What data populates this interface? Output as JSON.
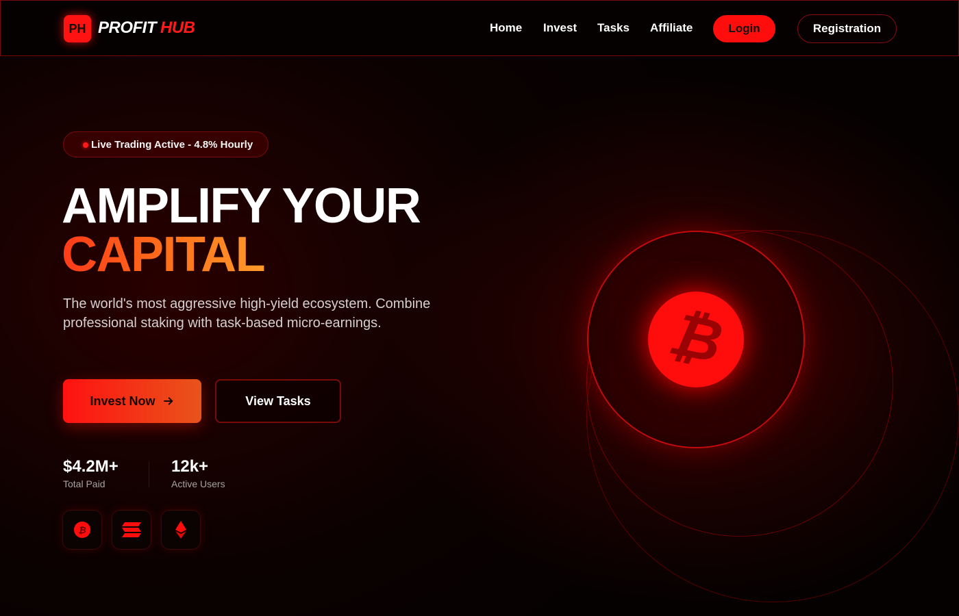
{
  "brand": {
    "mark": "PH",
    "name_part1": "PROFIT",
    "name_part2": "HUB"
  },
  "nav": {
    "links": [
      "Home",
      "Invest",
      "Tasks",
      "Affiliate"
    ],
    "login_label": "Login",
    "register_label": "Registration"
  },
  "hero": {
    "badge": "Live Trading Active - 4.8% Hourly",
    "headline_line1": "AMPLIFY YOUR",
    "headline_line2": "CAPITAL",
    "subtext": "The world's most aggressive high-yield ecosystem. Combine professional staking with task-based micro-earnings.",
    "primary_button": "Invest Now",
    "secondary_button": "View Tasks",
    "stats": [
      {
        "value": "$4.2M+",
        "label": "Total Paid"
      },
      {
        "value": "12k+",
        "label": "Active Users"
      }
    ],
    "coins": [
      "bitcoin-icon",
      "solana-icon",
      "ethereum-icon"
    ],
    "orb_symbol": "₿"
  },
  "colors": {
    "accent": "#ff0d0d",
    "background": "#050101",
    "gradient_start": "#ff3a1a",
    "gradient_end": "#ff9a2a"
  }
}
